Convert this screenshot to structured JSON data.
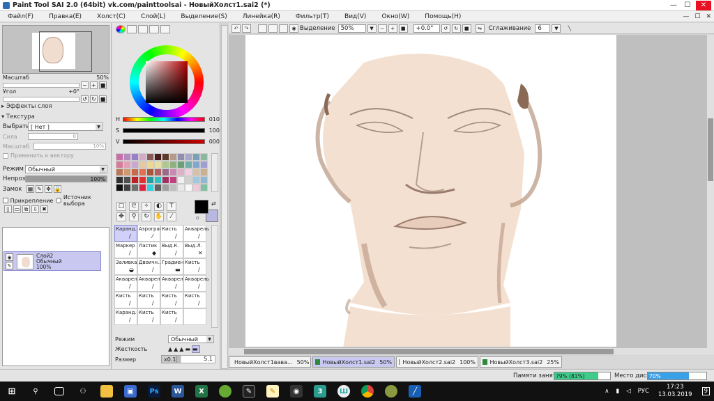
{
  "window": {
    "title": "Paint Tool SAI 2.0 (64bit) vk.com/painttoolsai - НовыйХолст1.sai2 (*)",
    "minimize": "—",
    "maximize": "☐",
    "close": "✕"
  },
  "menu": {
    "items": [
      "Файл(F)",
      "Правка(E)",
      "Холст(C)",
      "Слой(L)",
      "Выделение(S)",
      "Линейка(R)",
      "Фильтр(T)",
      "Вид(V)",
      "Окно(W)",
      "Помощь(H)"
    ],
    "right": [
      "—",
      "☐",
      "✕"
    ]
  },
  "navigator": {
    "zoom_label": "Масштаб",
    "zoom_value": "50%",
    "angle_label": "Угол",
    "angle_value": "+0°"
  },
  "layer_effects": {
    "label": "Эффекты слоя"
  },
  "texture": {
    "label": "Текстура",
    "select_label": "Выбрать",
    "select_value": "[ Нет ]",
    "strength_label": "Сила",
    "strength_value": "0",
    "scale_label": "Масштаб",
    "scale_value": "10%",
    "apply_vector_label": "Применить к вектору"
  },
  "layer_props": {
    "mode_label": "Режим",
    "mode_value": "Обычный",
    "opacity_label": "Непроз.",
    "opacity_value": "100%",
    "lock_label": "Замок",
    "clip_label": "Прикрепление",
    "source_label": "Источник выбора"
  },
  "layers": [
    {
      "name": "Слой2",
      "mode": "Обычный",
      "opacity": "100%"
    }
  ],
  "color": {
    "h_label": "H",
    "h_value": "010",
    "s_label": "S",
    "s_value": "100",
    "v_label": "V",
    "v_value": "000",
    "foreground": "#000000",
    "background": "#b8b8e0",
    "swatches": [
      "#c86fa8",
      "#b58bbf",
      "#9a7ec8",
      "#d6aac6",
      "#8a5a5a",
      "#4a1b1b",
      "#5d3a2a",
      "#b39a8a",
      "#8e8eb0",
      "#a8a8c8",
      "#7aa0b8",
      "#8cb8a0",
      "#d87a9a",
      "#e0a0b8",
      "#c8a8d0",
      "#e8c8a0",
      "#f0d890",
      "#e8e0a0",
      "#b0c890",
      "#90b080",
      "#6aa078",
      "#70b0a8",
      "#80a8d0",
      "#a0a0d0",
      "#b87858",
      "#d09870",
      "#c86a4a",
      "#e07050",
      "#a85838",
      "#b06060",
      "#9a6a8a",
      "#c88ab0",
      "#e0b0c8",
      "#f0d0e0",
      "#d8c0a8",
      "#c8b090",
      "#303030",
      "#505050",
      "#c02020",
      "#e03030",
      "#20a0a0",
      "#30c0c0",
      "#a03060",
      "#c04080",
      "#f0f0f0",
      "#d0d0d0",
      "#a0c8e0",
      "#90b8d0",
      "#101010",
      "#404040",
      "#707070",
      "#e02040",
      "#30d0e0",
      "#606060",
      "#a0a0a0",
      "#c0c0c0",
      "#e8e8e8",
      "#f8f8f8",
      "#f0c8d8",
      "#80c0a0"
    ]
  },
  "brushes": [
    {
      "label": "Каранд.",
      "selected": true,
      "icon": "pencil-icon",
      "glyph": "/"
    },
    {
      "label": "Аэрограф",
      "icon": "airbrush-icon",
      "glyph": "⁄"
    },
    {
      "label": "Кисть",
      "icon": "brush-icon",
      "glyph": "/"
    },
    {
      "label": "Акварель",
      "icon": "watercolor-icon",
      "glyph": "/"
    },
    {
      "label": "Маркер",
      "icon": "marker-icon",
      "glyph": "/"
    },
    {
      "label": "Ластик",
      "icon": "eraser-icon",
      "glyph": "◆"
    },
    {
      "label": "Выд.К.",
      "icon": "select-pen-icon",
      "glyph": "/"
    },
    {
      "label": "Выд.Л.",
      "icon": "select-eraser-icon",
      "glyph": "✕"
    },
    {
      "label": "Заливка",
      "icon": "bucket-icon",
      "glyph": "◒"
    },
    {
      "label": "Двоичн...",
      "icon": "binary-icon",
      "glyph": "/"
    },
    {
      "label": "Градиент",
      "icon": "gradient-icon",
      "glyph": "▬"
    },
    {
      "label": "Кисть",
      "icon": "brush-icon",
      "glyph": "/"
    },
    {
      "label": "Акварель",
      "icon": "watercolor-icon",
      "glyph": "/"
    },
    {
      "label": "Акварель",
      "icon": "watercolor-icon",
      "glyph": "/"
    },
    {
      "label": "Акварель",
      "icon": "watercolor-icon",
      "glyph": "/"
    },
    {
      "label": "Акварель",
      "icon": "watercolor-icon",
      "glyph": "/"
    },
    {
      "label": "Кисть",
      "icon": "brush-icon",
      "glyph": "/"
    },
    {
      "label": "Кисть",
      "icon": "brush-icon",
      "glyph": "/"
    },
    {
      "label": "Кисть",
      "icon": "brush-icon",
      "glyph": "/"
    },
    {
      "label": "Кисть",
      "icon": "brush-icon",
      "glyph": "/"
    },
    {
      "label": "Каранд.",
      "icon": "pencil-icon",
      "glyph": "/"
    },
    {
      "label": "Кисть",
      "icon": "brush-icon",
      "glyph": "/"
    },
    {
      "label": "Кисть",
      "icon": "brush-icon",
      "glyph": "/"
    },
    {
      "label": "",
      "icon": "",
      "glyph": ""
    }
  ],
  "brush_settings": {
    "mode_label": "Режим",
    "mode_value": "Обычный",
    "hardness_label": "Жесткость",
    "size_label": "Размер",
    "size_multiplier": "x0.1",
    "size_value": "5.1"
  },
  "canvas_toolbar": {
    "selection_label": "Выделение",
    "zoom_value": "50%",
    "angle_value": "+0.0°",
    "smoothing_label": "Сглаживание",
    "smoothing_value": "6"
  },
  "tabs": [
    {
      "name": "НовыйХолст1вава...",
      "zoom": "50%"
    },
    {
      "name": "НовыйХолст1.sai2",
      "zoom": "50%",
      "active": true
    },
    {
      "name": "НовыйХолст2.sai2",
      "zoom": "100%"
    },
    {
      "name": "НовыйХолст3.sai2",
      "zoom": "25%"
    }
  ],
  "status": {
    "memory_label": "Памяти занято",
    "memory_value": "79% (81%)",
    "memory_fraction": 0.79,
    "disk_label": "Место диска",
    "disk_value": "70%",
    "disk_fraction": 0.7
  },
  "taskbar": {
    "lang": "РУС",
    "time": "17:23",
    "date": "13.03.2019",
    "notifications": "9"
  }
}
